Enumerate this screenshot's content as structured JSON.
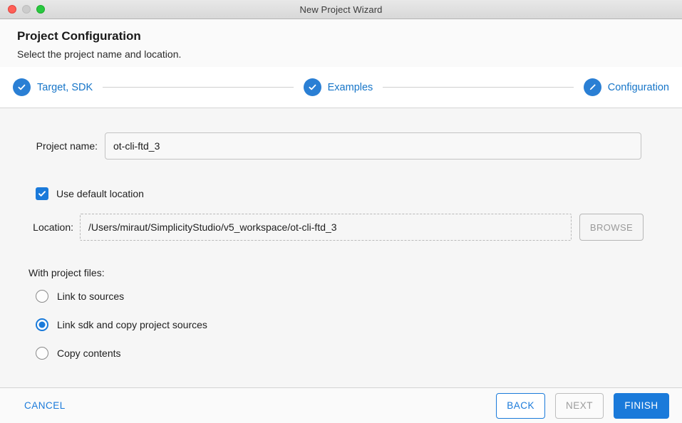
{
  "window": {
    "title": "New Project Wizard",
    "traffic_lights": [
      "close-button",
      "minimize-button",
      "maximize-button"
    ]
  },
  "header": {
    "title": "Project Configuration",
    "subtitle": "Select the project name and location."
  },
  "stepper": {
    "steps": [
      {
        "label": "Target, SDK",
        "icon": "check-icon",
        "state": "complete"
      },
      {
        "label": "Examples",
        "icon": "check-icon",
        "state": "complete"
      },
      {
        "label": "Configuration",
        "icon": "pencil-icon",
        "state": "current"
      }
    ]
  },
  "form": {
    "project_name": {
      "label": "Project name:",
      "value": "ot-cli-ftd_3",
      "placeholder": "Project name"
    },
    "use_default_location": {
      "label": "Use default location",
      "checked": true
    },
    "location": {
      "label": "Location:",
      "value": "/Users/miraut/SimplicityStudio/v5_workspace/ot-cli-ftd_3",
      "placeholder": "Location",
      "browse_label": "BROWSE",
      "browse_disabled": true
    },
    "project_files": {
      "label": "With project files:",
      "options": [
        {
          "label": "Link to sources",
          "selected": false
        },
        {
          "label": "Link sdk and copy project sources",
          "selected": true
        },
        {
          "label": "Copy contents",
          "selected": false
        }
      ]
    }
  },
  "footer": {
    "cancel_label": "CANCEL",
    "back_label": "BACK",
    "next_label": "NEXT",
    "next_disabled": true,
    "finish_label": "FINISH"
  },
  "colors": {
    "accent_blue": "#1a7ada",
    "step_blue": "#2a7fd4",
    "link_blue": "#1675c8",
    "body_bg": "#f6f6f6",
    "header_bg": "#fafafa",
    "close_red": "#ff5f57",
    "minimize_gray": "#cccccc",
    "maximize_green": "#28c840"
  }
}
